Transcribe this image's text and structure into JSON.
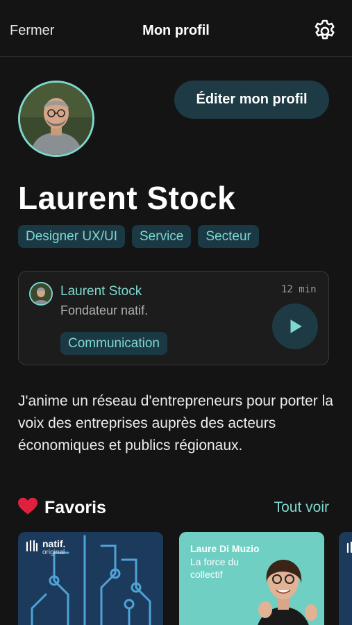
{
  "header": {
    "close_label": "Fermer",
    "title": "Mon profil",
    "settings_icon": "gear-icon"
  },
  "profile": {
    "name": "Laurent Stock",
    "edit_label": "Éditer mon profil",
    "tags": [
      "Designer UX/UI",
      "Service",
      "Secteur"
    ],
    "bio": "J'anime un réseau d'entrepreneurs pour porter la voix des entreprises auprès des acteurs économiques et publics régionaux."
  },
  "episode_card": {
    "author": "Laurent Stock",
    "role": "Fondateur natif.",
    "duration": "12 min",
    "tag": "Communication",
    "play_icon": "play-icon"
  },
  "favorites": {
    "title": "Favoris",
    "see_all_label": "Tout voir",
    "heart_icon": "heart-icon",
    "items": [
      {
        "brand": "natif.",
        "brand_sub": "original"
      },
      {
        "author": "Laure Di Muzio",
        "subtitle": "La force du collectif"
      }
    ]
  },
  "colors": {
    "background": "#141414",
    "accent": "#7fd8cf",
    "chip_bg": "#1a3944",
    "heart": "#e0203f"
  }
}
